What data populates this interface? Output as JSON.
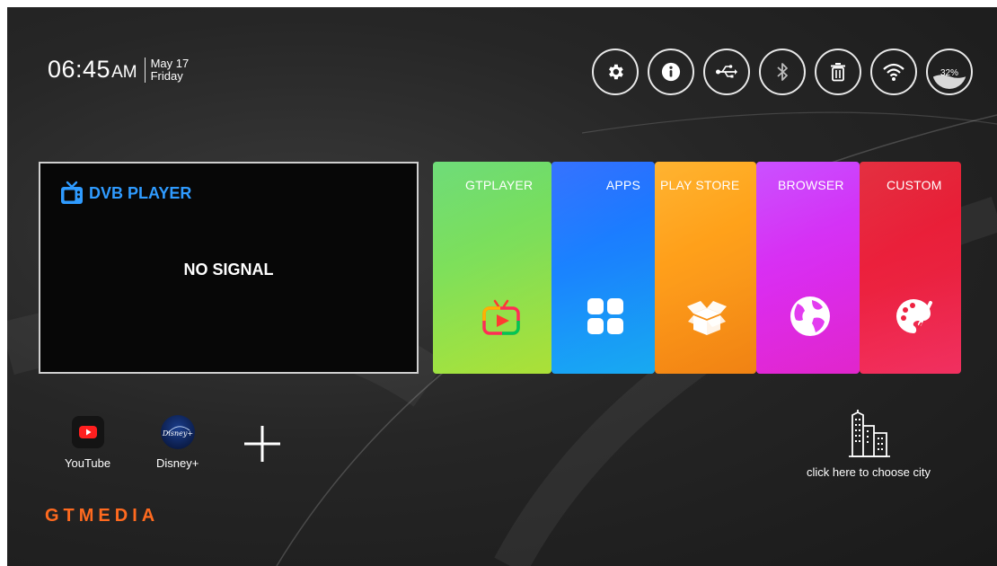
{
  "clock": {
    "time": "06:45",
    "ampm": "AM",
    "date": "May 17",
    "day": "Friday"
  },
  "status_bar": {
    "icons": [
      "settings-gear-icon",
      "info-icon",
      "usb-icon",
      "bluetooth-icon",
      "trash-icon",
      "wifi-icon",
      "storage-icon"
    ],
    "storage_percent": "32%"
  },
  "dvb": {
    "title": "DVB PLAYER",
    "status": "NO SIGNAL",
    "title_color": "#2f9bff"
  },
  "tiles": [
    {
      "label": "GTPLAYER",
      "icon": "gtplayer-play-icon",
      "color": "#7fe05a"
    },
    {
      "label": "APPS",
      "icon": "apps-grid-icon",
      "color": "#1a86ff"
    },
    {
      "label": "PLAY STORE",
      "icon": "box-icon",
      "color": "#ff9c1a"
    },
    {
      "label": "BROWSER",
      "icon": "globe-icon",
      "color": "#dd2cf0"
    },
    {
      "label": "CUSTOM",
      "icon": "palette-icon",
      "color": "#ee2240"
    }
  ],
  "shortcuts": [
    {
      "label": "YouTube",
      "icon": "youtube-icon"
    },
    {
      "label": "Disney+",
      "icon": "disney-plus-icon",
      "logo_text": "Disney+"
    }
  ],
  "add_shortcut": {
    "icon": "plus-icon"
  },
  "weather": {
    "prompt": "click here to choose city",
    "icon": "city-buildings-icon"
  },
  "brand": {
    "name": "GTMEDIA",
    "color": "#ff6a1f"
  }
}
